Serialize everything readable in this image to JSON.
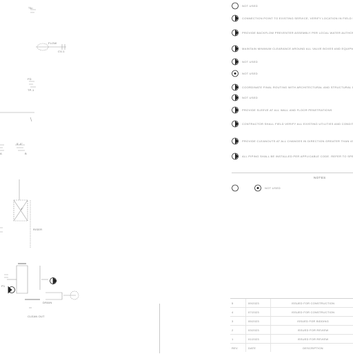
{
  "drawing": {
    "labels": [
      "T1",
      "FLOW",
      "CV-1",
      "FD",
      "TP-1",
      "5'-0\"",
      "A",
      "B",
      "4\"",
      "RISER",
      "DRAIN",
      "P1",
      "CLEAN OUT"
    ]
  },
  "notes": {
    "items": [
      {
        "marker": "circle",
        "text": "NOT USED"
      },
      {
        "marker": "arrow",
        "text": "CONNECTION POINT TO EXISTING SERVICE, VERIFY LOCATION IN FIELD PRIOR TO CONSTRUCTION"
      },
      {
        "marker": "arrow",
        "text": "PROVIDE BACKFLOW PREVENTER ASSEMBLY PER LOCAL WATER AUTHORITY REQUIREMENTS"
      },
      {
        "marker": "arrow",
        "text": "MAINTAIN MINIMUM CLEARANCE AROUND ALL VALVE BOXES AND EQUIPMENT PER MANUFACTURER"
      },
      {
        "marker": "arrow",
        "text": "NOT USED"
      },
      {
        "marker": "circle-dot",
        "text": "NOT USED"
      },
      {
        "marker": "arrow",
        "text": "COORDINATE FINAL ROUTING WITH ARCHITECTURAL AND STRUCTURAL DRAWINGS"
      },
      {
        "marker": "arrow",
        "text": "NOT USED"
      },
      {
        "marker": "arrow",
        "text": "PROVIDE SLEEVE AT ALL WALL AND FLOOR PENETRATIONS"
      },
      {
        "marker": "arrow",
        "text": "CONTRACTOR SHALL FIELD VERIFY ALL EXISTING UTILITIES AND CONDITIONS BEFORE BEGINNING WORK"
      },
      {
        "marker": "arrow",
        "text": "PROVIDE CLEANOUTS AT ALL CHANGES IN DIRECTION GREATER THAN 45 DEGREES"
      },
      {
        "marker": "arrow",
        "text": "ALL PIPING SHALL BE INSTALLED PER APPLICABLE CODE. REFER TO SPECIFICATIONS FOR MATERIALS"
      }
    ],
    "heading": "NOTES",
    "legend": [
      {
        "marker": "circle",
        "text": ""
      },
      {
        "marker": "circle-dot",
        "text": "NOT USED"
      }
    ]
  },
  "revisions": {
    "rows": [
      {
        "no": "5",
        "date": "09/2023",
        "description": "ISSUED FOR CONSTRUCTION"
      },
      {
        "no": "4",
        "date": "07/2023",
        "description": "ISSUED FOR CONSTRUCTION"
      },
      {
        "no": "3",
        "date": "05/2023",
        "description": "ISSUED FOR BIDDING"
      },
      {
        "no": "2",
        "date": "03/2023",
        "description": "ISSUED FOR REVIEW"
      },
      {
        "no": "1",
        "date": "01/2023",
        "description": "ISSUED FOR REVIEW"
      },
      {
        "no": "REV",
        "date": "DATE",
        "description": "DESCRIPTION"
      }
    ]
  }
}
